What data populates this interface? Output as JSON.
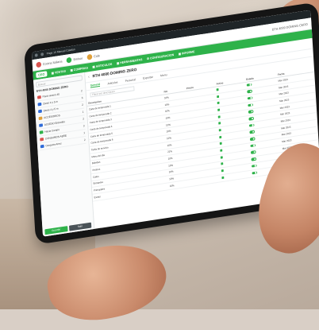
{
  "colors": {
    "brand_green": "#2eb24a",
    "bezel": "#151515",
    "browser_bar": "#1f2528"
  },
  "browser": {
    "url_text": "Page 10 Manuel Catalan"
  },
  "topbar": {
    "badges": [
      {
        "label": "Cocina Italiana",
        "color": "#d9534f"
      },
      {
        "label": "Emisor",
        "color": "#2eb24a"
      },
      {
        "label": "Cafe",
        "color": "#e0a03a"
      }
    ],
    "right_text": "BTH 4000 DOMING CERO"
  },
  "nav": {
    "logo": "CEO",
    "items": [
      {
        "label": "VENTAS",
        "icon": "cart-icon"
      },
      {
        "label": "COMPRAS",
        "icon": "bag-icon"
      },
      {
        "label": "ARTICULOS",
        "icon": "box-icon"
      },
      {
        "label": "HERRAMIENTAS",
        "icon": "tool-icon"
      },
      {
        "label": "CONFIGURACION",
        "icon": "gear-icon"
      },
      {
        "label": "INFORME",
        "icon": "chart-icon"
      }
    ]
  },
  "sidebar": {
    "search_placeholder": "Buscar",
    "title": "RTH 4000 DOMING ZERO",
    "items": [
      {
        "label": "Pack verano 40",
        "count": "2"
      },
      {
        "label": "Zaras 4 y 5 m",
        "count": "3"
      },
      {
        "label": "Zaras 4 y 5 m",
        "count": "2"
      },
      {
        "label": "ACCESORIOS",
        "count": "1"
      },
      {
        "label": "ACCESO Entradas",
        "count": "2"
      },
      {
        "label": "Hacia Campo",
        "count": "3"
      },
      {
        "label": "CONSUMOS ABRE",
        "count": "1"
      },
      {
        "label": "Conjunto Arroz",
        "count": "2"
      }
    ],
    "btn_primary": "Guardar",
    "btn_secondary": "Salir"
  },
  "content": {
    "title": "RTH 4000 DOMING ZERO",
    "tabs": [
      "General",
      "Articulos",
      "Personal",
      "Exportar",
      "Menu"
    ],
    "filter_placeholder": "Filtrar por descripcion",
    "headers": [
      "Descripcion",
      "IVA",
      "Precio",
      "Activo",
      "Estado",
      "Fecha"
    ],
    "rows": [
      {
        "desc": "Carta de temporada 1",
        "iva": "10%",
        "price": "",
        "date": "Mar 2023"
      },
      {
        "desc": "Carta de temporada 2",
        "iva": "10%",
        "price": "",
        "date": "Mar 2023"
      },
      {
        "desc": "Carta de temporada 3",
        "iva": "10%",
        "price": "",
        "date": "Mar 2023"
      },
      {
        "desc": "Carta de temporada 4",
        "iva": "10%",
        "price": "",
        "date": "Mar 2023"
      },
      {
        "desc": "Carta de temporada 5",
        "iva": "10%",
        "price": "",
        "date": "Mar 2023"
      },
      {
        "desc": "Carta de temporada 6",
        "iva": "10%",
        "price": "",
        "date": "Mar 2023"
      },
      {
        "desc": "Tarifa de servicio",
        "iva": "10%",
        "price": "",
        "date": "Mar 2023"
      },
      {
        "desc": "Menu del dia",
        "iva": "10%",
        "price": "",
        "date": "Mar 2023"
      },
      {
        "desc": "Bebidas",
        "iva": "21%",
        "price": "",
        "date": "Mar 2023"
      },
      {
        "desc": "Postres",
        "iva": "10%",
        "price": "",
        "date": "Mar 2023"
      },
      {
        "desc": "Cafes",
        "iva": "10%",
        "price": "",
        "date": "Mar 2023"
      },
      {
        "desc": "Entrantes",
        "iva": "10%",
        "price": "",
        "date": "Mar 2023"
      },
      {
        "desc": "Principales",
        "iva": "10%",
        "price": "",
        "date": "Mar 2023"
      },
      {
        "desc": "Extras",
        "iva": "10%",
        "price": "",
        "date": "Mar 2023"
      }
    ]
  }
}
